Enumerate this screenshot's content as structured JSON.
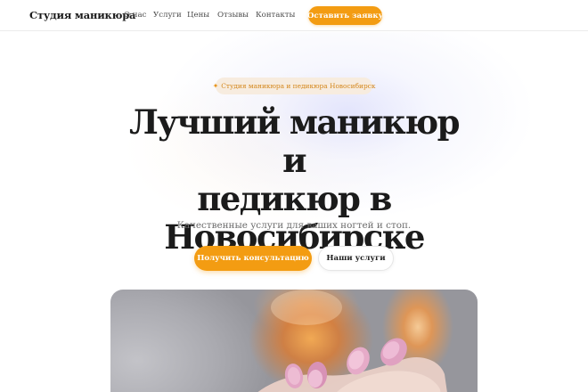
{
  "header": {
    "brand": "Студия маникюра",
    "nav": [
      "О нас",
      "Услуги",
      "Цены",
      "Отзывы",
      "Контакты"
    ],
    "cta_label": "Оставить заявку"
  },
  "hero": {
    "badge_icon": "star-icon",
    "badge_text": "Студия маникюра и педикюра Новосибирск",
    "title_lines": [
      "Лучший маникюр и",
      "педикюр в",
      "Новосибирске"
    ],
    "subtitle": "Качественные услуги для ваших ногтей и стоп.",
    "primary_button": "Получить консультацию",
    "secondary_button": "Наши услуги",
    "image_subject": "manicured-hand-photo"
  },
  "colors": {
    "accent": "#f39c12",
    "accent_text": "#d4871c",
    "badge_bg": "#f7ecdf",
    "title": "#1b1b1b",
    "subtitle": "#6b6b6b",
    "nav_text": "#4b4b4b"
  }
}
